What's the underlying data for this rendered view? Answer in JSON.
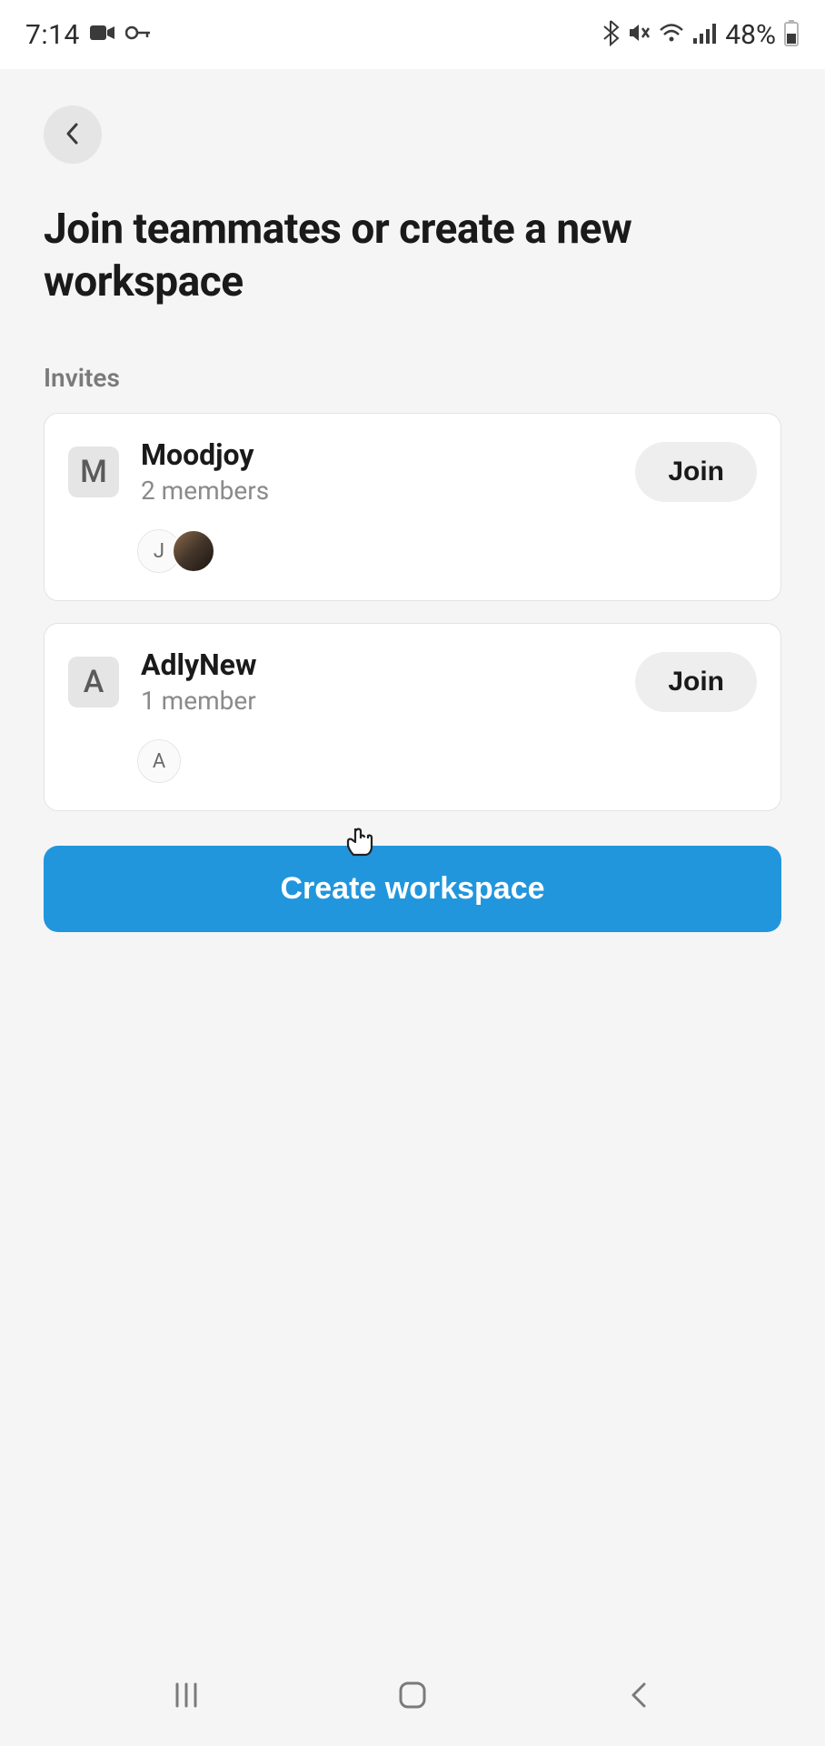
{
  "statusBar": {
    "time": "7:14",
    "batteryPct": "48%"
  },
  "page": {
    "title": "Join teammates or create a new workspace",
    "sectionLabel": "Invites",
    "createBtn": "Create workspace"
  },
  "invites": [
    {
      "avatarLetter": "M",
      "name": "Moodjoy",
      "membersText": "2 members",
      "joinLabel": "Join",
      "memberAvatars": [
        {
          "type": "letter",
          "letter": "J"
        },
        {
          "type": "photo"
        }
      ]
    },
    {
      "avatarLetter": "A",
      "name": "AdlyNew",
      "membersText": "1 member",
      "joinLabel": "Join",
      "memberAvatars": [
        {
          "type": "letter",
          "letter": "A"
        }
      ]
    }
  ]
}
